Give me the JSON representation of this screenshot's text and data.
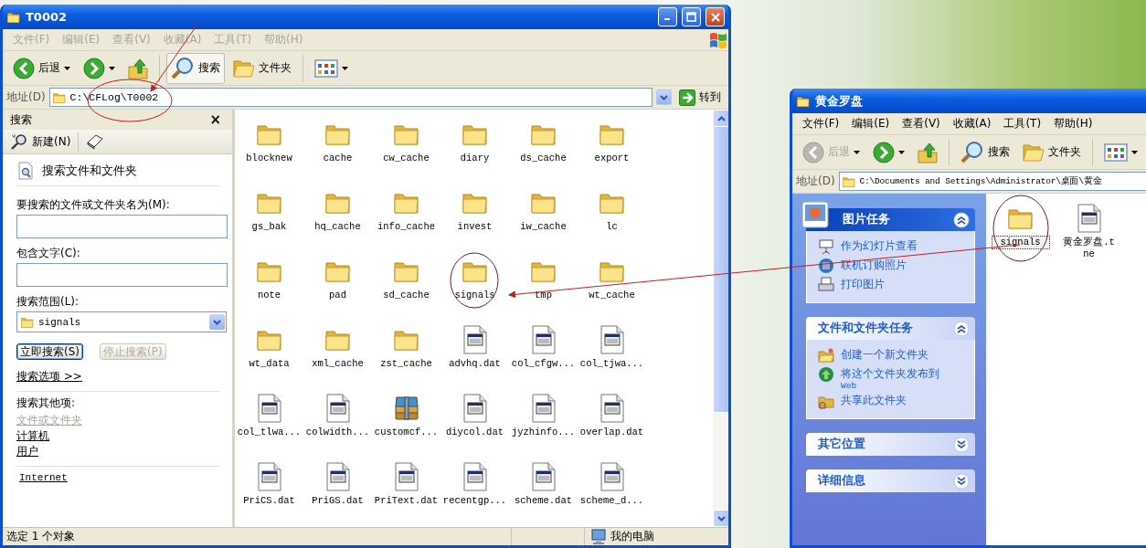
{
  "explorer_window": {
    "title": "T0002",
    "menu": [
      {
        "label": "文件(F)",
        "disabled": true
      },
      {
        "label": "编辑(E)",
        "disabled": true
      },
      {
        "label": "查看(V)",
        "disabled": true
      },
      {
        "label": "收藏(A)",
        "disabled": true
      },
      {
        "label": "工具(T)",
        "disabled": true
      },
      {
        "label": "帮助(H)",
        "disabled": true
      }
    ],
    "toolbar": [
      {
        "kind": "back",
        "label": "后退",
        "disabled": false
      },
      {
        "kind": "forward",
        "disabled": false
      },
      {
        "kind": "up"
      },
      {
        "kind": "search",
        "label": "搜索",
        "selected": true
      },
      {
        "kind": "folders",
        "label": "文件夹",
        "selected": false
      },
      {
        "kind": "views"
      }
    ],
    "address": {
      "label": "地址(D)",
      "value": "C:\\CFLog\\T0002",
      "go": "转到"
    },
    "search_pane": {
      "title": "搜索",
      "close": "×",
      "new_button": "新建(N)",
      "heading": "搜索文件和文件夹",
      "name_label": "要搜索的文件或文件夹名为(M):",
      "text_label": "包含文字(C):",
      "scope_label": "搜索范围(L):",
      "scope_value": "signals",
      "search_button": "立即搜索(S)",
      "stop_button": "停止搜索(P)",
      "stop_disabled": true,
      "options_link": "搜索选项 >>",
      "other_label": "搜索其他项:",
      "other_links": [
        {
          "label": "文件或文件夹",
          "disabled": true
        },
        {
          "label": "计算机",
          "disabled": false
        },
        {
          "label": "用户",
          "disabled": false
        }
      ],
      "internet_link": "Internet"
    },
    "files": [
      {
        "name": "blocknew",
        "kind": "folder",
        "selected": false
      },
      {
        "name": "cache",
        "kind": "folder",
        "selected": false
      },
      {
        "name": "cw_cache",
        "kind": "folder",
        "selected": false
      },
      {
        "name": "diary",
        "kind": "folder",
        "selected": false
      },
      {
        "name": "ds_cache",
        "kind": "folder",
        "selected": false
      },
      {
        "name": "export",
        "kind": "folder",
        "selected": false
      },
      {
        "name": "gs_bak",
        "kind": "folder",
        "selected": false
      },
      {
        "name": "hq_cache",
        "kind": "folder",
        "selected": false
      },
      {
        "name": "info_cache",
        "kind": "folder",
        "selected": false
      },
      {
        "name": "invest",
        "kind": "folder",
        "selected": false
      },
      {
        "name": "iw_cache",
        "kind": "folder",
        "selected": false
      },
      {
        "name": "lc",
        "kind": "folder",
        "selected": false
      },
      {
        "name": "note",
        "kind": "folder",
        "selected": false
      },
      {
        "name": "pad",
        "kind": "folder",
        "selected": false
      },
      {
        "name": "sd_cache",
        "kind": "folder",
        "selected": false
      },
      {
        "name": "signals",
        "kind": "folder",
        "selected": false
      },
      {
        "name": "tmp",
        "kind": "folder",
        "selected": false
      },
      {
        "name": "wt_cache",
        "kind": "folder",
        "selected": false
      },
      {
        "name": "wt_data",
        "kind": "folder",
        "selected": false
      },
      {
        "name": "xml_cache",
        "kind": "folder",
        "selected": false
      },
      {
        "name": "zst_cache",
        "kind": "folder",
        "selected": false
      },
      {
        "name": "advhq.dat",
        "kind": "file",
        "selected": false
      },
      {
        "name": "col_cfgw...",
        "kind": "file",
        "selected": false
      },
      {
        "name": "col_tjwa...",
        "kind": "file",
        "selected": false
      },
      {
        "name": "col_tlwa...",
        "kind": "file",
        "selected": false
      },
      {
        "name": "colwidth...",
        "kind": "file",
        "selected": false
      },
      {
        "name": "customcf...",
        "kind": "archive",
        "selected": false
      },
      {
        "name": "diycol.dat",
        "kind": "file",
        "selected": false
      },
      {
        "name": "jyzhinfo...",
        "kind": "file",
        "selected": false
      },
      {
        "name": "overlap.dat",
        "kind": "file",
        "selected": false
      },
      {
        "name": "PriCS.dat",
        "kind": "file",
        "selected": false
      },
      {
        "name": "PriGS.dat",
        "kind": "file",
        "selected": false
      },
      {
        "name": "PriText.dat",
        "kind": "file",
        "selected": false
      },
      {
        "name": "recentgp...",
        "kind": "file",
        "selected": false
      },
      {
        "name": "scheme.dat",
        "kind": "file",
        "selected": false
      },
      {
        "name": "scheme_d...",
        "kind": "file",
        "selected": false
      }
    ],
    "status_bar": {
      "selection": "选定 1 个对象",
      "location": "我的电脑"
    }
  },
  "folder_window": {
    "title": "黄金罗盘",
    "menu": [
      {
        "label": "文件(F)",
        "disabled": false
      },
      {
        "label": "编辑(E)",
        "disabled": false
      },
      {
        "label": "查看(V)",
        "disabled": false
      },
      {
        "label": "收藏(A)",
        "disabled": false
      },
      {
        "label": "工具(T)",
        "disabled": false
      },
      {
        "label": "帮助(H)",
        "disabled": false
      }
    ],
    "toolbar": [
      {
        "kind": "back",
        "label": "后退",
        "disabled": true
      },
      {
        "kind": "forward",
        "disabled": false
      },
      {
        "kind": "up"
      },
      {
        "kind": "search",
        "label": "搜索",
        "selected": false
      },
      {
        "kind": "folders",
        "label": "文件夹",
        "selected": false
      },
      {
        "kind": "views"
      }
    ],
    "address": {
      "label": "地址(D)",
      "value": "C:\\Documents and Settings\\Administrator\\桌面\\黄金"
    },
    "task_panels": [
      {
        "kind": "picture",
        "title": "图片任务",
        "expanded": true,
        "items": [
          {
            "kind": "slideshow",
            "label": "作为幻灯片查看"
          },
          {
            "kind": "order",
            "label": "联机订购照片"
          },
          {
            "kind": "print",
            "label": "打印图片"
          }
        ]
      },
      {
        "kind": "plain",
        "title": "文件和文件夹任务",
        "expanded": true,
        "items": [
          {
            "kind": "new-folder",
            "label": "创建一个新文件夹"
          },
          {
            "kind": "publish",
            "label": "将这个文件夹发布到",
            "sub": "Web"
          },
          {
            "kind": "share",
            "label": "共享此文件夹"
          }
        ]
      },
      {
        "kind": "plain",
        "title": "其它位置",
        "expanded": false
      },
      {
        "kind": "plain",
        "title": "详细信息",
        "expanded": false
      }
    ],
    "files": [
      {
        "name": "signals",
        "kind": "folder",
        "selected": true
      },
      {
        "name": "黄金罗盘.tne",
        "kind": "file",
        "selected": false
      }
    ]
  }
}
